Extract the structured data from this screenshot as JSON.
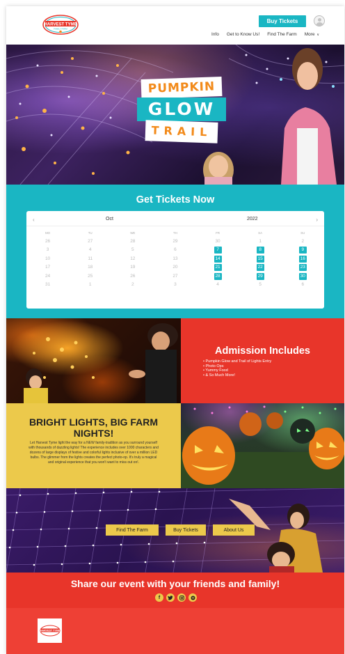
{
  "header": {
    "logo_text": "HARVEST TYME",
    "logo_subtext": "FAMILY FARM",
    "buy_label": "Buy Tickets",
    "nav": {
      "info": "Info",
      "get_to_know": "Get to Know Us!",
      "find_farm": "Find The Farm",
      "more": "More",
      "more_chevron": "∨"
    }
  },
  "hero": {
    "line1": "PUMPKIN",
    "line2": "GLOW",
    "line3": "TRAIL"
  },
  "tickets": {
    "title": "Get Tickets Now",
    "calendar": {
      "prev": "‹",
      "next": "›",
      "month": "Oct",
      "year": "2022",
      "weekdays": [
        "MO",
        "TU",
        "WE",
        "TH",
        "FR",
        "SA",
        "SU"
      ],
      "weeks": [
        [
          {
            "d": "26",
            "a": false
          },
          {
            "d": "27",
            "a": false
          },
          {
            "d": "28",
            "a": false
          },
          {
            "d": "29",
            "a": false
          },
          {
            "d": "30",
            "a": false
          },
          {
            "d": "1",
            "a": false
          },
          {
            "d": "2",
            "a": false
          }
        ],
        [
          {
            "d": "3",
            "a": false
          },
          {
            "d": "4",
            "a": false
          },
          {
            "d": "5",
            "a": false
          },
          {
            "d": "6",
            "a": false
          },
          {
            "d": "7",
            "a": true
          },
          {
            "d": "8",
            "a": true
          },
          {
            "d": "9",
            "a": true
          }
        ],
        [
          {
            "d": "10",
            "a": false
          },
          {
            "d": "11",
            "a": false
          },
          {
            "d": "12",
            "a": false
          },
          {
            "d": "13",
            "a": false
          },
          {
            "d": "14",
            "a": true
          },
          {
            "d": "15",
            "a": true
          },
          {
            "d": "16",
            "a": true
          }
        ],
        [
          {
            "d": "17",
            "a": false
          },
          {
            "d": "18",
            "a": false
          },
          {
            "d": "19",
            "a": false
          },
          {
            "d": "20",
            "a": false
          },
          {
            "d": "21",
            "a": true
          },
          {
            "d": "22",
            "a": true
          },
          {
            "d": "23",
            "a": true
          }
        ],
        [
          {
            "d": "24",
            "a": false
          },
          {
            "d": "25",
            "a": false
          },
          {
            "d": "26",
            "a": false
          },
          {
            "d": "27",
            "a": false
          },
          {
            "d": "28",
            "a": true
          },
          {
            "d": "29",
            "a": true
          },
          {
            "d": "30",
            "a": true
          }
        ],
        [
          {
            "d": "31",
            "a": false
          },
          {
            "d": "1",
            "a": false
          },
          {
            "d": "2",
            "a": false
          },
          {
            "d": "3",
            "a": false
          },
          {
            "d": "4",
            "a": false
          },
          {
            "d": "5",
            "a": false
          },
          {
            "d": "6",
            "a": false
          }
        ]
      ]
    }
  },
  "admission": {
    "title": "Admission Includes",
    "items": [
      "Pumpkin Glow and Trail of Lights Entry",
      "Photo Ops",
      "Yummy Food",
      "& So Much More!"
    ]
  },
  "bright": {
    "title_line1": "BRIGHT LIGHTS, BIG FARM",
    "title_line2": "NIGHTS!",
    "body": "Let Harvest Tyme light the way for a NEW family-tradition as you surround yourself with thousands of dazzling lights! The experience includes over 1000 characters and dozens of large displays of festive and colorful lights inclusive of over a million LED bulbs. The glimmer from the lights creates the perfect photo-op. It's truly a magical and original experience that you won't want to miss out on!."
  },
  "band": {
    "find_farm": "Find The Farm",
    "buy_tickets": "Buy Tickets",
    "about": "About Us"
  },
  "share": {
    "title": "Share our event with your friends and family!",
    "icons": [
      "f",
      "t",
      "ig",
      "s"
    ]
  },
  "footer": {
    "logo_text": "HARVEST TYME"
  },
  "colors": {
    "teal": "#1ab6c3",
    "red": "#e8352a",
    "yellow": "#ecc94b",
    "orange": "#f28a1a"
  }
}
